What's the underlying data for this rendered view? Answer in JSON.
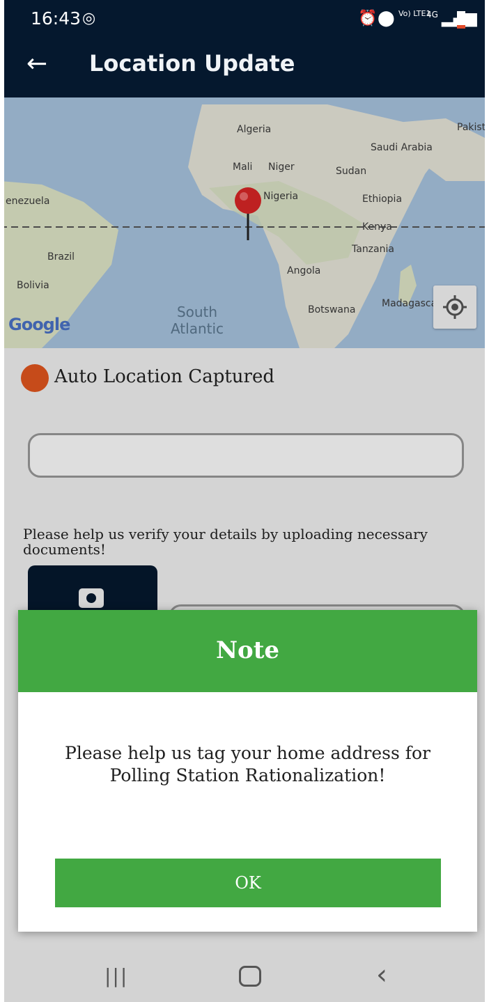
{
  "status_bar": {
    "time": "16:43",
    "network": "4G",
    "volte": "Vo) LTE1",
    "icons": [
      "sync-icon",
      "alarm-icon",
      "location-icon",
      "signal-icon",
      "battery-icon"
    ]
  },
  "app_bar": {
    "title": "Location Update",
    "back_icon": "arrow-left-icon"
  },
  "map": {
    "labels": {
      "algeria": "Algeria",
      "pakistan": "Pakist",
      "saudi": "Saudi Arabia",
      "mali": "Mali",
      "niger": "Niger",
      "sudan": "Sudan",
      "venezuela": "enezuela",
      "nigeria": "Nigeria",
      "ethiopia": "Ethiopia",
      "kenya": "Kenya",
      "tanzania": "Tanzania",
      "brazil": "Brazil",
      "angola": "Angola",
      "bolivia": "Bolivia",
      "madagascar": "Madagasca",
      "botswana": "Botswana",
      "south_atlantic": "South Atlantic",
      "google": "Google"
    },
    "marker_icon": "map-pin-icon",
    "locate_icon": "my-location-icon"
  },
  "form": {
    "auto_location_label": "Auto Location Captured",
    "address_value": "",
    "verify_text": "Please help us verify your details by uploading necessary documents!",
    "camera_icon": "camera-icon"
  },
  "dialog": {
    "title": "Note",
    "message": "Please help us tag your home address for Polling Station Rationalization!",
    "ok_label": "OK"
  },
  "colors": {
    "app_bar": "#05182e",
    "accent_green": "#42a842",
    "location_orange": "#e2561e"
  },
  "nav": {
    "icons": [
      "recent-apps-icon",
      "home-icon",
      "back-icon"
    ]
  }
}
